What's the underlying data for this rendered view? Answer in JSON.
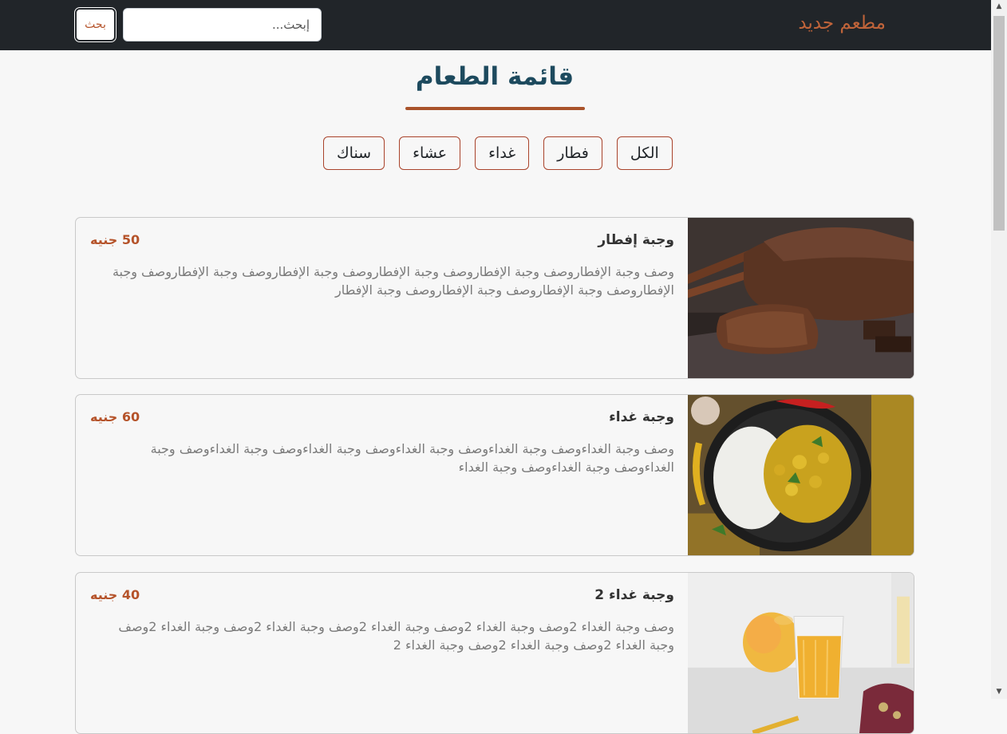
{
  "navbar": {
    "brand": "مطعم جديد",
    "search_placeholder": "إبحث...",
    "search_button": "بحث"
  },
  "menu": {
    "title": "قائمة الطعام",
    "filters": [
      "الكل",
      "فطار",
      "غداء",
      "عشاء",
      "سناك"
    ]
  },
  "items": [
    {
      "title": "وجبة إفطار",
      "price": "50 جنيه",
      "description": "وصف وجبة الإفطاروصف وجبة الإفطاروصف وجبة الإفطاروصف وجبة الإفطاروصف وجبة الإفطاروصف وجبة الإفطاروصف وجبة الإفطاروصف وجبة الإفطاروصف وجبة الإفطار",
      "image_icon": "bread-loaf-image"
    },
    {
      "title": "وجبة غداء",
      "price": "60 جنيه",
      "description": "وصف وجبة الغداءوصف وجبة الغداءوصف وجبة الغداءوصف وجبة الغداءوصف وجبة الغداءوصف وجبة الغداءوصف وجبة الغداءوصف وجبة الغداء",
      "image_icon": "curry-rice-image"
    },
    {
      "title": "وجبة غداء 2",
      "price": "40 جنيه",
      "description": "وصف وجبة الغداء 2وصف وجبة الغداء 2وصف وجبة الغداء 2وصف وجبة الغداء 2وصف وجبة الغداء 2وصف وجبة الغداء 2وصف وجبة الغداء 2وصف وجبة الغداء 2",
      "image_icon": "mango-juice-image"
    }
  ],
  "colors": {
    "navbar_bg": "#212529",
    "accent": "#b5532a",
    "title": "#1d4a5e"
  }
}
